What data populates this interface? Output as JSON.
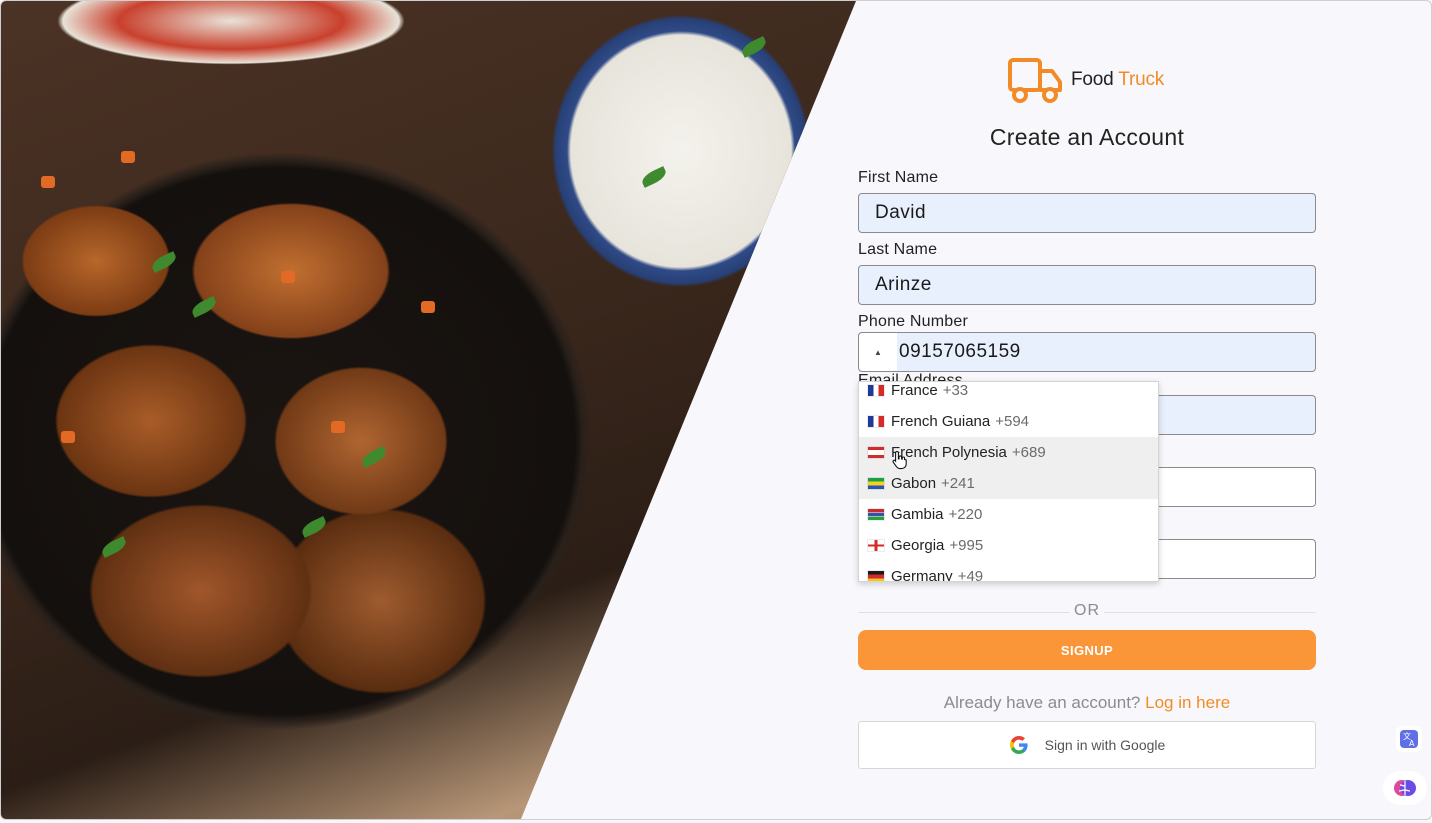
{
  "brand": {
    "name_prefix": "Food",
    "name_suffix": "Truck",
    "accent": "#f28b26",
    "icon": "truck-icon"
  },
  "page_title": "Create an Account",
  "fields": {
    "first_name": {
      "label": "First Name",
      "value": "David"
    },
    "last_name": {
      "label": "Last Name",
      "value": "Arinze"
    },
    "phone": {
      "label": "Phone Number",
      "value": "09157065159",
      "country_caret": "▲"
    },
    "email": {
      "label": "Email Address"
    }
  },
  "country_dropdown": {
    "items": [
      {
        "name": "France",
        "code": "+33",
        "flag": "flag-france",
        "highlighted": false
      },
      {
        "name": "French Guiana",
        "code": "+594",
        "flag": "flag-french-guiana",
        "highlighted": false
      },
      {
        "name": "French Polynesia",
        "code": "+689",
        "flag": "flag-french-polynesia",
        "highlighted": true
      },
      {
        "name": "Gabon",
        "code": "+241",
        "flag": "flag-gabon",
        "highlighted": true
      },
      {
        "name": "Gambia",
        "code": "+220",
        "flag": "flag-gambia",
        "highlighted": false
      },
      {
        "name": "Georgia",
        "code": "+995",
        "flag": "flag-georgia",
        "highlighted": false
      },
      {
        "name": "Germany",
        "code": "+49",
        "flag": "flag-germany",
        "highlighted": false
      }
    ]
  },
  "divider_text": "OR",
  "signup_label": "SIGNUP",
  "login_prompt": {
    "text": "Already have an account?",
    "link": "Log in here"
  },
  "google_button": "Sign in with Google",
  "colors": {
    "signup": "#fb9638",
    "field_fill": "#e8f0fe",
    "link": "#f28b26"
  }
}
